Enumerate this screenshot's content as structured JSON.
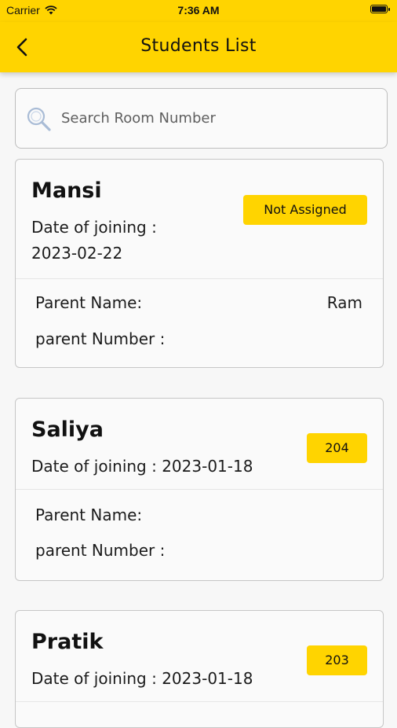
{
  "status_bar": {
    "carrier": "Carrier",
    "time": "7:36 AM"
  },
  "header": {
    "title": "Students List",
    "back_icon": "chevron-left-icon"
  },
  "search": {
    "placeholder": "Search Room Number",
    "icon": "search-icon"
  },
  "students": [
    {
      "name": "Mansi",
      "doj_label": "Date of joining :",
      "doj": "2023-02-22",
      "status": "Not Assigned",
      "parent_name_label": "Parent Name:",
      "parent_name": "Ram",
      "parent_number_label": "parent Number :",
      "parent_number": ""
    },
    {
      "name": "Saliya",
      "doj_label": "Date of joining :",
      "doj": "2023-01-18",
      "status": "204",
      "parent_name_label": "Parent Name:",
      "parent_name": "",
      "parent_number_label": "parent Number :",
      "parent_number": ""
    },
    {
      "name": "Pratik",
      "doj_label": "Date of joining :",
      "doj": "2023-01-18",
      "status": "203"
    }
  ],
  "colors": {
    "accent": "#ffd400",
    "background": "#f7f7f7",
    "card_border": "#c6c6c6"
  }
}
